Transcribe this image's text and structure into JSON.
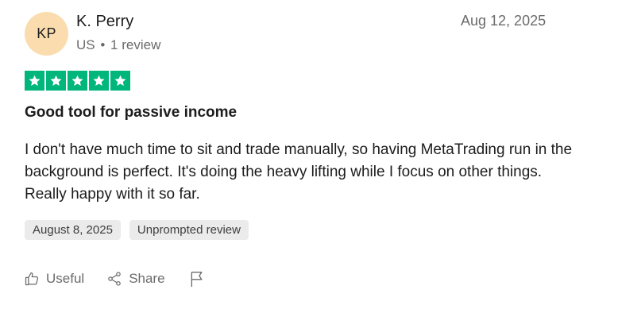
{
  "reviewer": {
    "initials": "KP",
    "name": "K. Perry",
    "country": "US",
    "separator": "•",
    "review_count": "1 review"
  },
  "review": {
    "date": "Aug 12, 2025",
    "rating": 5,
    "rating_max": 5,
    "title": "Good tool for passive income",
    "body": "I don't have much time to sit and trade manually, so having MetaTrading run in the background is perfect. It's doing the heavy lifting while I focus on other things. Really happy with it so far.",
    "tags": {
      "experience_date": "August 8, 2025",
      "review_type": "Unprompted review"
    }
  },
  "actions": {
    "useful_label": "Useful",
    "share_label": "Share",
    "flag_icon": "flag-icon"
  },
  "colors": {
    "avatar_bg": "#fbdcae",
    "star_green": "#00b67a",
    "tag_bg": "#ebebeb",
    "muted_text": "#6b6b6b"
  }
}
